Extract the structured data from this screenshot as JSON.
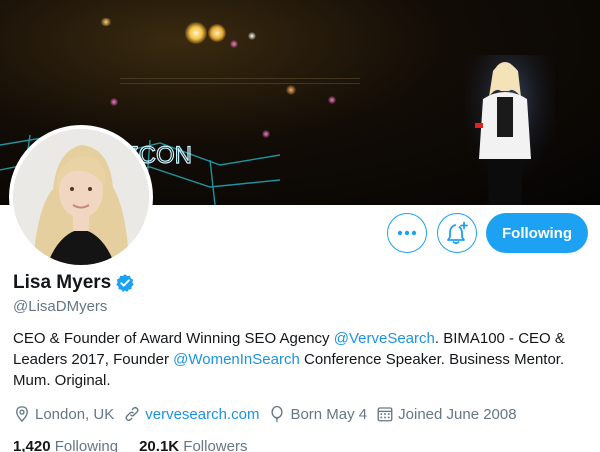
{
  "banner": {
    "sign_text": "ZCON"
  },
  "profile": {
    "name": "Lisa Myers",
    "handle": "@LisaDMyers",
    "bio": {
      "part1": "CEO & Founder of Award Winning SEO Agency ",
      "mention1": "@VerveSearch",
      "part2": ". BIMA100 - CEO & Leaders 2017, Founder ",
      "mention2": "@WomenInSearch",
      "part3": " Conference Speaker. Business Mentor. Mum. Original."
    },
    "location": "London, UK",
    "website": "vervesearch.com",
    "birthday": "Born May 4",
    "joined": "Joined June 2008"
  },
  "stats": {
    "following_count": "1,420",
    "following_label": "Following",
    "followers_count": "20.1K",
    "followers_label": "Followers"
  },
  "actions": {
    "follow_label": "Following"
  },
  "icons": {
    "more": "more-icon",
    "notifications": "bell-plus-icon",
    "verified": "verified-badge-icon",
    "location": "location-pin-icon",
    "link": "link-icon",
    "birthday": "balloon-icon",
    "calendar": "calendar-icon"
  },
  "colors": {
    "accent": "#1da1f2",
    "link": "#1b95e0",
    "secondary_text": "#657786",
    "primary_text": "#14171a"
  }
}
